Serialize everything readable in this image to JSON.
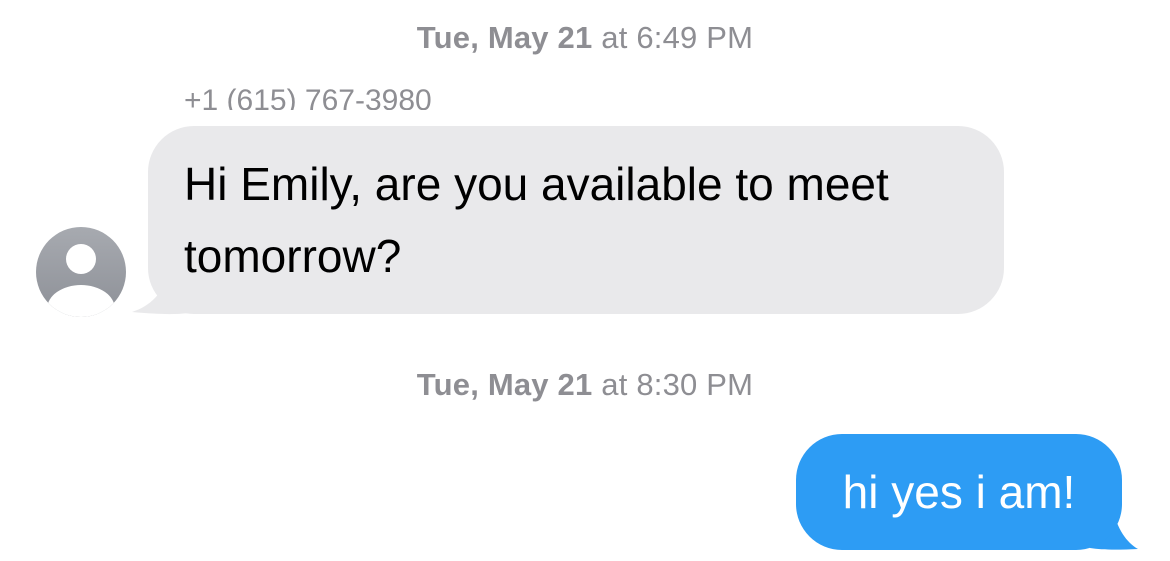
{
  "conversation": {
    "messages": [
      {
        "timestamp_day": "Tue, May 21",
        "timestamp_sep": "at",
        "timestamp_time": "6:49 PM",
        "sender": "+1 (615) 767-3980",
        "direction": "incoming",
        "text": "Hi Emily, are you available to meet tomorrow?"
      },
      {
        "timestamp_day": "Tue, May 21",
        "timestamp_sep": "at",
        "timestamp_time": "8:30 PM",
        "direction": "outgoing",
        "text": "hi yes i am!"
      }
    ]
  },
  "colors": {
    "incoming_bubble": "#e9e9eb",
    "outgoing_bubble": "#2d9cf4",
    "timestamp": "#8e8e93"
  },
  "icons": {
    "avatar": "person-placeholder-icon"
  }
}
